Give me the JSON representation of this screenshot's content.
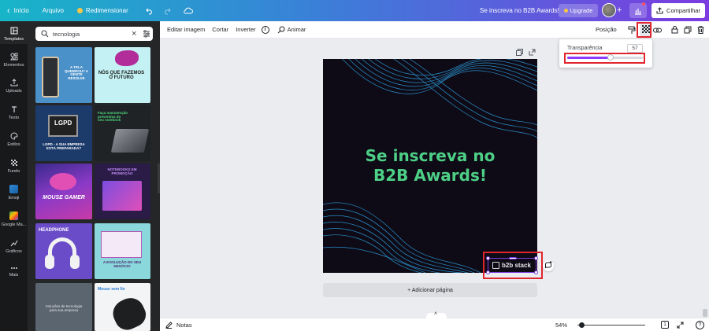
{
  "topbar": {
    "home_label": "Início",
    "file_label": "Arquivo",
    "resize_label": "Redimensionar",
    "doc_title": "Se inscreva no B2B Awards!",
    "upgrade_label": "Upgrade",
    "share_label": "Compartilhar",
    "gradient_start": "#17b5c8",
    "gradient_end": "#7c3ce0"
  },
  "leftnav": {
    "items": [
      {
        "label": "Templates",
        "icon": "templates-icon"
      },
      {
        "label": "Elementos",
        "icon": "elements-icon"
      },
      {
        "label": "Uploads",
        "icon": "upload-icon"
      },
      {
        "label": "Texto",
        "icon": "text-icon"
      },
      {
        "label": "Estilos",
        "icon": "styles-icon"
      },
      {
        "label": "Fundo",
        "icon": "background-icon"
      },
      {
        "label": "Emoji",
        "icon": "emoji-icon"
      },
      {
        "label": "Google Ma...",
        "icon": "google-maps-icon"
      },
      {
        "label": "Gráficos",
        "icon": "charts-icon"
      },
      {
        "label": "Mais",
        "icon": "more-icon"
      }
    ]
  },
  "panel": {
    "search_value": "tecnologia",
    "thumbs": [
      {
        "text": "A TELA QUEBROU? A GENTE RESOLVE"
      },
      {
        "text": "NÓS QUE FAZEMOS O FUTURO"
      },
      {
        "text": "LGPD - A SUA EMPRESA ESTÁ PREPARADA?"
      },
      {
        "text": "Faça manutenção preventiva do seu notebook"
      },
      {
        "text": "MOUSE GAMER"
      },
      {
        "text": "NOTEBOOKS EM PROMOÇÃO"
      },
      {
        "text": "HEADPHONE"
      },
      {
        "text": "A EVOLUÇÃO DO SEU NEGÓCIO"
      },
      {
        "text": "Soluções de tecnologia para sua empresa"
      },
      {
        "text": "Mouse sem fio"
      }
    ]
  },
  "toolbar": {
    "edit_image": "Editar imagem",
    "crop": "Cortar",
    "flip": "Inverter",
    "animate": "Animar",
    "position": "Posição"
  },
  "canvas": {
    "headline_line1": "Se inscreva no",
    "headline_line2": "B2B Awards!",
    "logo_text": "b2b stack",
    "headline_color": "#4dcf86",
    "background": "#0e0b17"
  },
  "transparency": {
    "label": "Transparência",
    "value": "57",
    "level_percent": 57
  },
  "add_page_label": "+ Adicionar página",
  "bottombar": {
    "notes_label": "Notas",
    "zoom_label": "54%",
    "page_number": "1"
  }
}
